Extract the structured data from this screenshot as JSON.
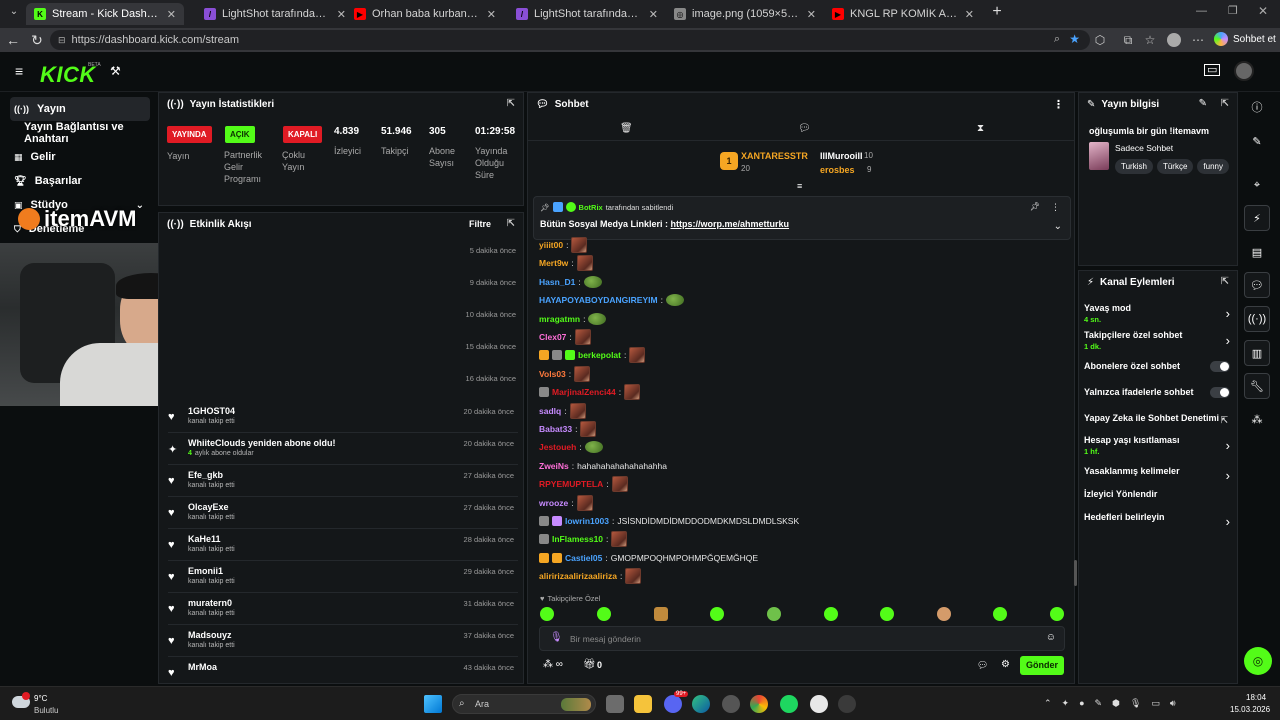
{
  "browser": {
    "tabs": [
      {
        "title": "Stream - Kick Dashboard",
        "color": "#53fc18",
        "fav": "K"
      },
      {
        "title": "LightShot tarafından Ekran Görünt",
        "color": "#8a4fd6",
        "fav": "/"
      },
      {
        "title": "Orhan baba kurban oluyum dişler",
        "color": "#ff0000",
        "fav": "▶"
      },
      {
        "title": "LightShot tarafından Ekran Görünt",
        "color": "#8a4fd6",
        "fav": "/"
      },
      {
        "title": "image.png (1059×538)",
        "color": "#888888",
        "fav": "◎"
      },
      {
        "title": "KNGL RP KOMİK ANLAR #6 (GÜN",
        "color": "#ff0000",
        "fav": "▶"
      }
    ],
    "url": "https://dashboard.kick.com/stream",
    "profile_label": "Sohbet et"
  },
  "header": {
    "logo": "KICK",
    "beta": "BETA"
  },
  "sidebar": {
    "items": [
      {
        "label": "Yayın",
        "icon": "broadcast-icon"
      },
      {
        "label": "Yayın Bağlantısı ve Anahtarı",
        "icon": ""
      },
      {
        "label": "Gelir",
        "icon": "revenue-icon"
      },
      {
        "label": "Başarılar",
        "icon": "trophy-icon"
      },
      {
        "label": "Stüdyo",
        "icon": "studio-icon"
      },
      {
        "label": "Denetleme",
        "icon": "shield-icon"
      }
    ],
    "watermark": "itemAVM"
  },
  "stats": {
    "title": "Yayın İstatistikleri",
    "tags": [
      {
        "label": "YAYINDA",
        "caption": "Yayın",
        "color": "#e01b24"
      },
      {
        "label": "AÇIK",
        "caption": "Partnerlik Gelir Programı",
        "color": "#53fc18"
      },
      {
        "label": "KAPALI",
        "caption": "Çoklu Yayın",
        "color": "#e01b24"
      }
    ],
    "numbers": [
      {
        "value": "4.839",
        "caption": "İzleyici"
      },
      {
        "value": "51.946",
        "caption": "Takipçi"
      },
      {
        "value": "305",
        "caption": "Abone Sayısı"
      },
      {
        "value": "01:29:58",
        "caption": "Yayında Olduğu Süre"
      }
    ]
  },
  "activity": {
    "title": "Etkinlik Akışı",
    "filter": "Filtre",
    "hidden_times": [
      "5 dakika önce",
      "9 dakika önce",
      "10 dakika önce",
      "15 dakika önce",
      "16 dakika önce"
    ],
    "rows": [
      {
        "name": "1GHOST04",
        "sub": "kanalı takip etti",
        "time": "20 dakika önce",
        "icon": "heart"
      },
      {
        "name": "WhiiteClouds yeniden abone oldu!",
        "sub_num": "4",
        "sub": "aylık abone oldular",
        "time": "20 dakika önce",
        "icon": "sparkle"
      },
      {
        "name": "Efe_gkb",
        "sub": "kanalı takip etti",
        "time": "27 dakika önce",
        "icon": "heart"
      },
      {
        "name": "OlcayExe",
        "sub": "kanalı takip etti",
        "time": "27 dakika önce",
        "icon": "heart"
      },
      {
        "name": "KaHe11",
        "sub": "kanalı takip etti",
        "time": "28 dakika önce",
        "icon": "heart"
      },
      {
        "name": "Emonii1",
        "sub": "kanalı takip etti",
        "time": "29 dakika önce",
        "icon": "heart"
      },
      {
        "name": "muratern0",
        "sub": "kanalı takip etti",
        "time": "31 dakika önce",
        "icon": "heart"
      },
      {
        "name": "Madsouyz",
        "sub": "kanalı takip etti",
        "time": "37 dakika önce",
        "icon": "heart"
      },
      {
        "name": "MrMoa",
        "sub": "",
        "time": "43 dakika önce",
        "icon": "heart"
      }
    ]
  },
  "chat": {
    "title": "Sohbet",
    "leaders": [
      {
        "rank": "1",
        "name": "XANTARESSTR",
        "count": "20"
      },
      {
        "name": "IllMurooiII",
        "count": "10"
      },
      {
        "name": "erosbes",
        "count": "9"
      }
    ],
    "pinned": {
      "by": "BotRix",
      "by_suffix": "tarafından sabitlendi",
      "text": "Bütün Sosyal Medya Linkleri : ",
      "link": "https://worp.me/ahmetturku"
    },
    "messages": [
      {
        "user": "yiiit00",
        "color": "#f5a623",
        "text": "",
        "emote": "red"
      },
      {
        "user": "Mert9w",
        "color": "#f5a623",
        "text": "",
        "emote": "red"
      },
      {
        "user": "Hasn_D1",
        "color": "#4aa3ff",
        "text": "",
        "emote": "pepe"
      },
      {
        "user": "HAYAPOYABOYDANGIREYIM",
        "color": "#4aa3ff",
        "text": "",
        "emote": "pepe"
      },
      {
        "user": "mragatmn",
        "color": "#53fc18",
        "text": "",
        "emote": "pepe"
      },
      {
        "user": "Clex07",
        "color": "#ff6fd8",
        "text": "",
        "emote": "red"
      },
      {
        "user": "berkepolat",
        "color": "#53fc18",
        "text": "",
        "emote": "red",
        "badges": [
          "#f5a623",
          "#888",
          "#53fc18"
        ]
      },
      {
        "user": "Vols03",
        "color": "#ff7a3d",
        "text": "",
        "emote": "red"
      },
      {
        "user": "MarjinalZenci44",
        "color": "#e01b24",
        "text": "",
        "emote": "red",
        "badges": [
          "#888"
        ]
      },
      {
        "user": "sadlq",
        "color": "#c78bff",
        "text": "",
        "emote": "red"
      },
      {
        "user": "Babat33",
        "color": "#c78bff",
        "text": "",
        "emote": "red"
      },
      {
        "user": "Jestoueh",
        "color": "#e01b24",
        "text": "",
        "emote": "pepe"
      },
      {
        "user": "ZweiNs",
        "color": "#ff6fd8",
        "text": "hahahahahahahahahha",
        "emote": ""
      },
      {
        "user": "RPYEMUPTELA",
        "color": "#e01b24",
        "text": "",
        "emote": "red"
      },
      {
        "user": "wrooze",
        "color": "#c78bff",
        "text": "",
        "emote": "red"
      },
      {
        "user": "lowrin1003",
        "color": "#4aa3ff",
        "text": "JSİSNDİDMDİDMDDODMDKMDSLDMDLSKSK",
        "emote": "",
        "badges": [
          "#888",
          "#c78bff"
        ]
      },
      {
        "user": "InFlamess10",
        "color": "#53fc18",
        "text": "",
        "emote": "red",
        "badges": [
          "#888"
        ]
      },
      {
        "user": "Castiel05",
        "color": "#4aa3ff",
        "text": "GMOPMPOQHMPOHMPĞQEMĞHQE",
        "emote": "",
        "badges": [
          "#f5a623",
          "#f5a623"
        ]
      },
      {
        "user": "aliririzaalirizaaliriza",
        "color": "#f5a623",
        "text": "",
        "emote": "red"
      }
    ],
    "followers_only": "Takipçilere Özel",
    "placeholder": "Bir mesaj gönderin",
    "points": "0",
    "send": "Gönder"
  },
  "info": {
    "title": "Yayın bilgisi",
    "stream_title": "oğluşumla bir gün !itemavm",
    "category": "Sadece Sohbet",
    "tags": [
      "Turkish",
      "Türkçe",
      "funny"
    ]
  },
  "actions": {
    "title": "Kanal Eylemleri",
    "items": [
      {
        "label": "Yavaş mod",
        "sub": "4 sn.",
        "ctl": "chevron"
      },
      {
        "label": "Takipçilere özel sohbet",
        "sub": "1 dk.",
        "ctl": "chevron"
      },
      {
        "label": "Abonelere özel sohbet",
        "sub": "",
        "ctl": "toggle"
      },
      {
        "label": "Yalnızca ifadelerle sohbet",
        "sub": "",
        "ctl": "toggle"
      },
      {
        "label": "Yapay Zeka ile Sohbet Denetimi",
        "sub": "",
        "ctl": "external"
      },
      {
        "label": "Hesap yaşı kısıtlaması",
        "sub": "1 hf.",
        "ctl": "chevron"
      },
      {
        "label": "Yasaklanmış kelimeler",
        "sub": "",
        "ctl": "chevron"
      },
      {
        "label": "İzleyici Yönlendir",
        "sub": "",
        "ctl": ""
      },
      {
        "label": "Hedefleri belirleyin",
        "sub": "",
        "ctl": "chevron"
      }
    ]
  },
  "taskbar": {
    "weather_temp": "9°C",
    "weather_desc": "Bulutlu",
    "search": "Ara",
    "time": "18:04",
    "date": "15.03.2026",
    "notif_badge": "99+"
  }
}
